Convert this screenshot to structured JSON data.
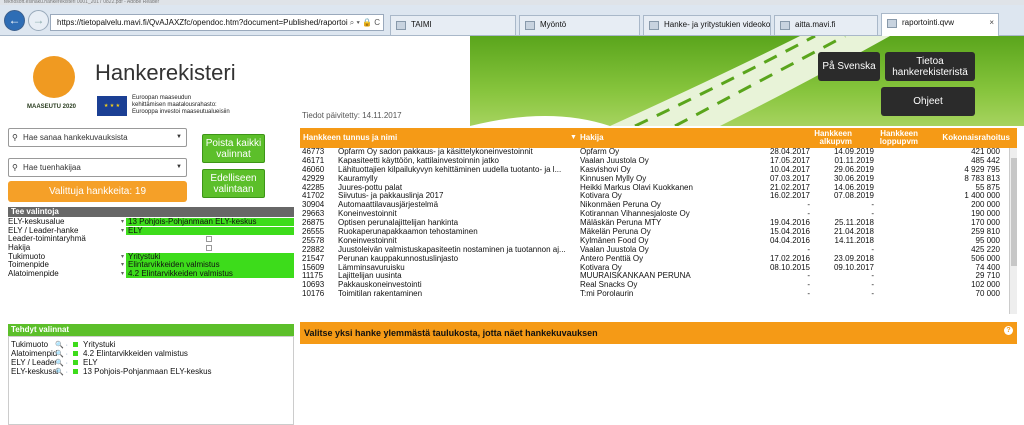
{
  "browser": {
    "top_strip": "teknosoft.esihaku.hankerekisteri 0001_2017 0822.pdf - Adobe Reader",
    "address": "https://tietopalvelu.mavi.fi/QvAJAXZfc/opendoc.htm?document=Published/raportoi",
    "address_icons": "⌕ ▾ 🔒 C",
    "tabs": [
      {
        "label": "TAIMI"
      },
      {
        "label": "Myöntö"
      },
      {
        "label": "Hanke- ja yritystukien videoko..."
      },
      {
        "label": "aitta.mavi.fi"
      },
      {
        "label": "raportointi.qvw"
      }
    ]
  },
  "app": {
    "title": "Hankerekisteri",
    "logo_text": "MAASEUTU 2020",
    "eu_flag": "★ ★ ★",
    "eu_text": [
      "Euroopan maaseudun",
      "kehittämisen maatalousrahasto:",
      "Eurooppa investoi maaseutualueisiin"
    ],
    "updated": "Tiedot päivitetty: 14.11.2017",
    "buttons": {
      "svenska": "På Svenska",
      "info": "Tietoa hankerekisteristä",
      "help": "Ohjeet",
      "clear": "Poista kaikki valinnat",
      "previous": "Edelliseen valintaan"
    },
    "search_projects_placeholder": "Hae sanaa hankekuvauksista",
    "search_applicant_placeholder": "Hae tuenhakijaa",
    "selected_count": "Valittuja hankkeita:   19"
  },
  "filters": {
    "header": "Tee valintoja",
    "rows": [
      {
        "label": "ELY-keskusalue",
        "value": "13 Pohjois-Pohjanmaan ELY-keskus",
        "selected": true
      },
      {
        "label": "ELY / Leader-hanke",
        "value": "ELY",
        "selected": true
      },
      {
        "label": "Leader-toimintaryhmä",
        "value": "",
        "selected": false,
        "checkbox": true
      },
      {
        "label": "Hakija",
        "value": "",
        "selected": false,
        "checkbox": true
      },
      {
        "label": "Tukimuoto",
        "value": "Yritystuki",
        "selected": true
      },
      {
        "label": "Toimenpide",
        "value": "Elintarvikkeiden valmistus",
        "selected": true
      },
      {
        "label": "Alatoimenpide",
        "value": "4.2 Elintarvikkeiden valmistus",
        "selected": true
      }
    ]
  },
  "selections": {
    "header": "Tehdyt valinnat",
    "rows": [
      {
        "key": "Tukimuoto",
        "value": "Yritystuki"
      },
      {
        "key": "Alatoimenpid",
        "value": "4.2 Elintarvikkeiden valmistus"
      },
      {
        "key": "ELY / Leader",
        "value": "ELY"
      },
      {
        "key": "ELY-keskusal",
        "value": "13 Pohjois-Pohjanmaan ELY-keskus"
      }
    ],
    "icons": "🔍 ·"
  },
  "table": {
    "headers": {
      "id_name": "Hankkeen tunnus ja nimi",
      "applicant": "Hakija",
      "start": "Hankkeen alkupvm",
      "end": "Hankkeen loppupvm",
      "sum": "Kokonaisrahoitus"
    },
    "rows": [
      {
        "id": "46773",
        "name": "Opfarm Oy sadon pakkaus- ja käsittelykoneinvestoinnit",
        "applicant": "Opfarm Oy",
        "start": "28.04.2017",
        "end": "14.09.2019",
        "sum": "421 000"
      },
      {
        "id": "46171",
        "name": "Kapasiteetti käyttöön, kattilainvestoinnin jatko",
        "applicant": "Vaalan Juustola Oy",
        "start": "17.05.2017",
        "end": "01.11.2019",
        "sum": "485 442"
      },
      {
        "id": "46060",
        "name": "Lähituottajien kilpailukyvyn kehittäminen uudella tuotanto- ja l...",
        "applicant": "Kasvishovi Oy",
        "start": "10.04.2017",
        "end": "29.06.2019",
        "sum": "4 929 795"
      },
      {
        "id": "42929",
        "name": "Kauramylly",
        "applicant": "Kinnusen Mylly Oy",
        "start": "07.03.2017",
        "end": "30.06.2019",
        "sum": "8 783 813"
      },
      {
        "id": "42285",
        "name": "Juures-pottu palat",
        "applicant": "Heikki Markus Olavi Kuokkanen",
        "start": "21.02.2017",
        "end": "14.06.2019",
        "sum": "55 875"
      },
      {
        "id": "41702",
        "name": "Siivutus- ja pakkauslinja 2017",
        "applicant": "Kotivara Oy",
        "start": "16.02.2017",
        "end": "07.08.2019",
        "sum": "1 400 000"
      },
      {
        "id": "30904",
        "name": "Automaattilavausjärjestelmä",
        "applicant": "Nikonmäen Peruna Oy",
        "start": "-",
        "end": "-",
        "sum": "200 000"
      },
      {
        "id": "29663",
        "name": "Koneinvestoinnit",
        "applicant": "Kotirannan Vihannesjaloste Oy",
        "start": "-",
        "end": "-",
        "sum": "190 000"
      },
      {
        "id": "26875",
        "name": "Optisen perunalajittelijan hankinta",
        "applicant": "Mäläskän Peruna MTY",
        "start": "19.04.2016",
        "end": "25.11.2018",
        "sum": "170 000"
      },
      {
        "id": "26555",
        "name": "Ruokaperunapakkaamon tehostaminen",
        "applicant": "Mäkelän Peruna Oy",
        "start": "15.04.2016",
        "end": "21.04.2018",
        "sum": "259 810"
      },
      {
        "id": "25578",
        "name": "Koneinvestoinnit",
        "applicant": "Kylmänen Food Oy",
        "start": "04.04.2016",
        "end": "14.11.2018",
        "sum": "95 000"
      },
      {
        "id": "22882",
        "name": "Juustoleivän valmistuskapasiteetin nostaminen ja tuotannon aj...",
        "applicant": "Vaalan Juustola Oy",
        "start": "-",
        "end": "-",
        "sum": "425 220"
      },
      {
        "id": "21547",
        "name": "Perunan kauppakunnostuslinjasto",
        "applicant": "Antero Penttiä Oy",
        "start": "17.02.2016",
        "end": "23.09.2018",
        "sum": "506 000"
      },
      {
        "id": "15609",
        "name": "Lämminsavuruisku",
        "applicant": "Kotivara Oy",
        "start": "08.10.2015",
        "end": "09.10.2017",
        "sum": "74 400"
      },
      {
        "id": "11175",
        "name": "Lajittelijan uusinta",
        "applicant": "MUURAISKANKAAN PERUNA",
        "start": "-",
        "end": "-",
        "sum": "29 710"
      },
      {
        "id": "10693",
        "name": "Pakkauskoneinvestointi",
        "applicant": "Real Snacks Oy",
        "start": "-",
        "end": "-",
        "sum": "102 000"
      },
      {
        "id": "10176",
        "name": "Toimitilan rakentaminen",
        "applicant": "T:mi Porolaurin",
        "start": "-",
        "end": "-",
        "sum": "70 000"
      }
    ],
    "hint": "Valitse yksi hanke ylemmästä taulukosta, jotta näet hankekuvauksen",
    "hint_icon": "?"
  },
  "colors": {
    "orange": "#f59a16",
    "green": "#5cbf2a",
    "selected_green": "#3ddc1b",
    "dark": "#2b2b2b"
  }
}
